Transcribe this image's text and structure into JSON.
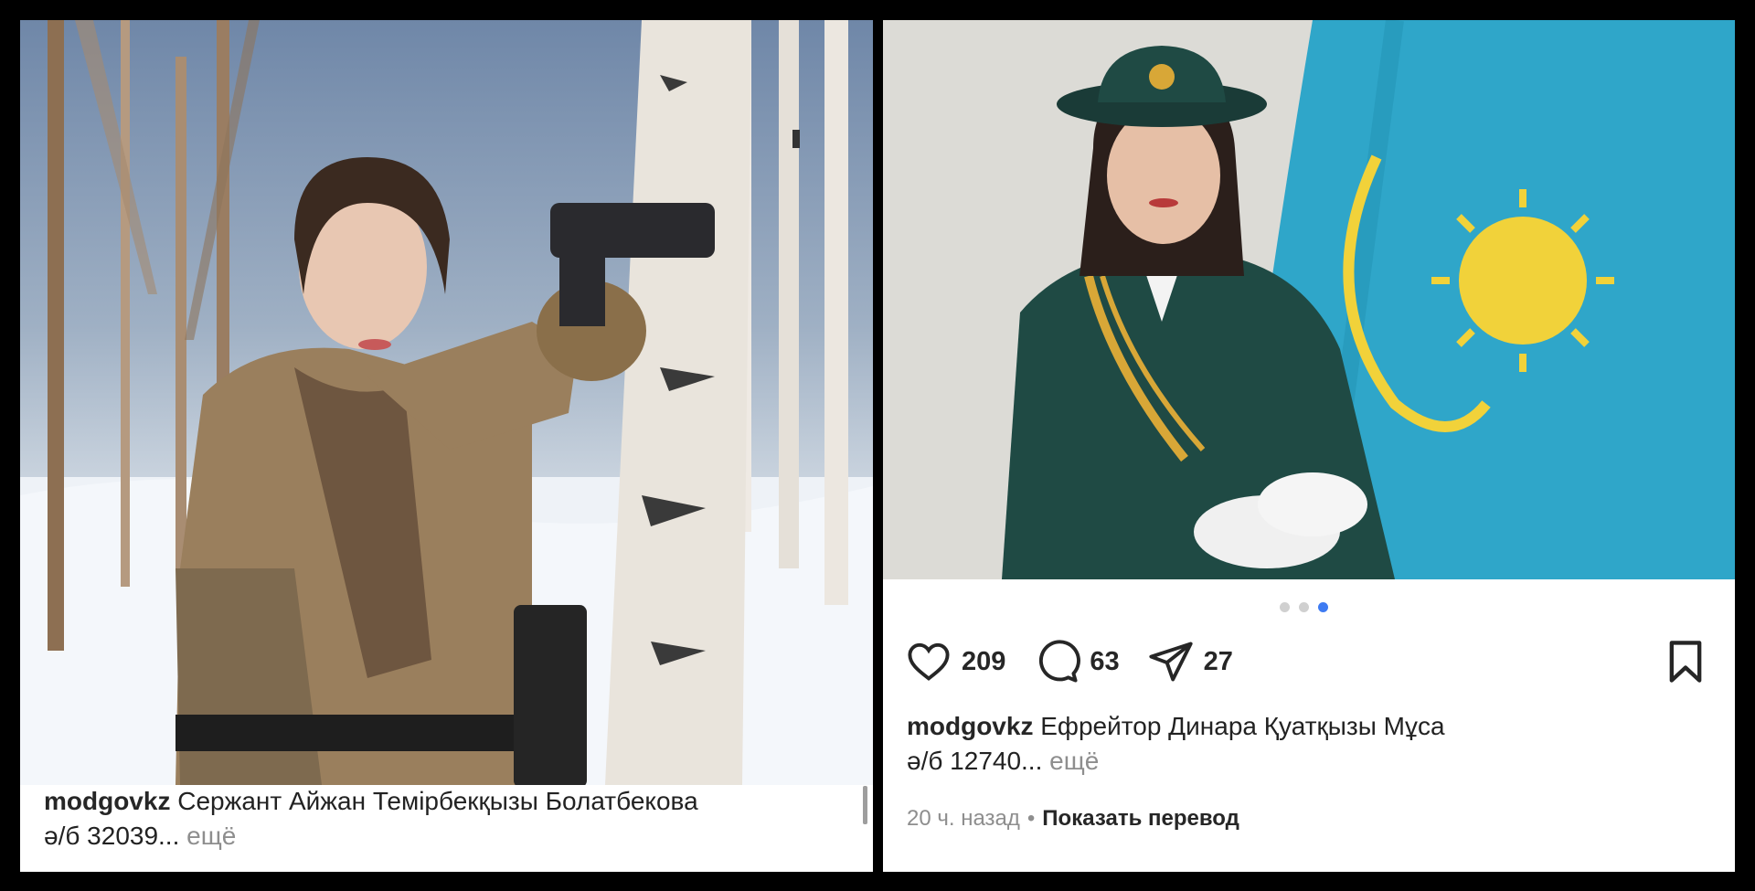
{
  "left_post": {
    "username": "modgovkz",
    "caption_line1": "Сержант Айжан Темірбекқызы Болатбекова",
    "caption_line2": "ә/б 32039...",
    "more_label": "ещё"
  },
  "right_post": {
    "carousel": {
      "total": 3,
      "active": 3
    },
    "likes": "209",
    "comments": "63",
    "shares": "27",
    "username": "modgovkz",
    "caption_line1": "Ефрейтор Динара Қуатқызы Мұса",
    "caption_line2": "ә/б 12740...",
    "more_label": "ещё",
    "time": "20 ч. назад",
    "separator": "•",
    "translate_label": "Показать перевод"
  },
  "colors": {
    "background": "#000000",
    "active_dot": "#3e7bf2",
    "muted_text": "#8e8e8e"
  },
  "icons": [
    "heart-icon",
    "comment-icon",
    "share-icon",
    "bookmark-icon"
  ]
}
